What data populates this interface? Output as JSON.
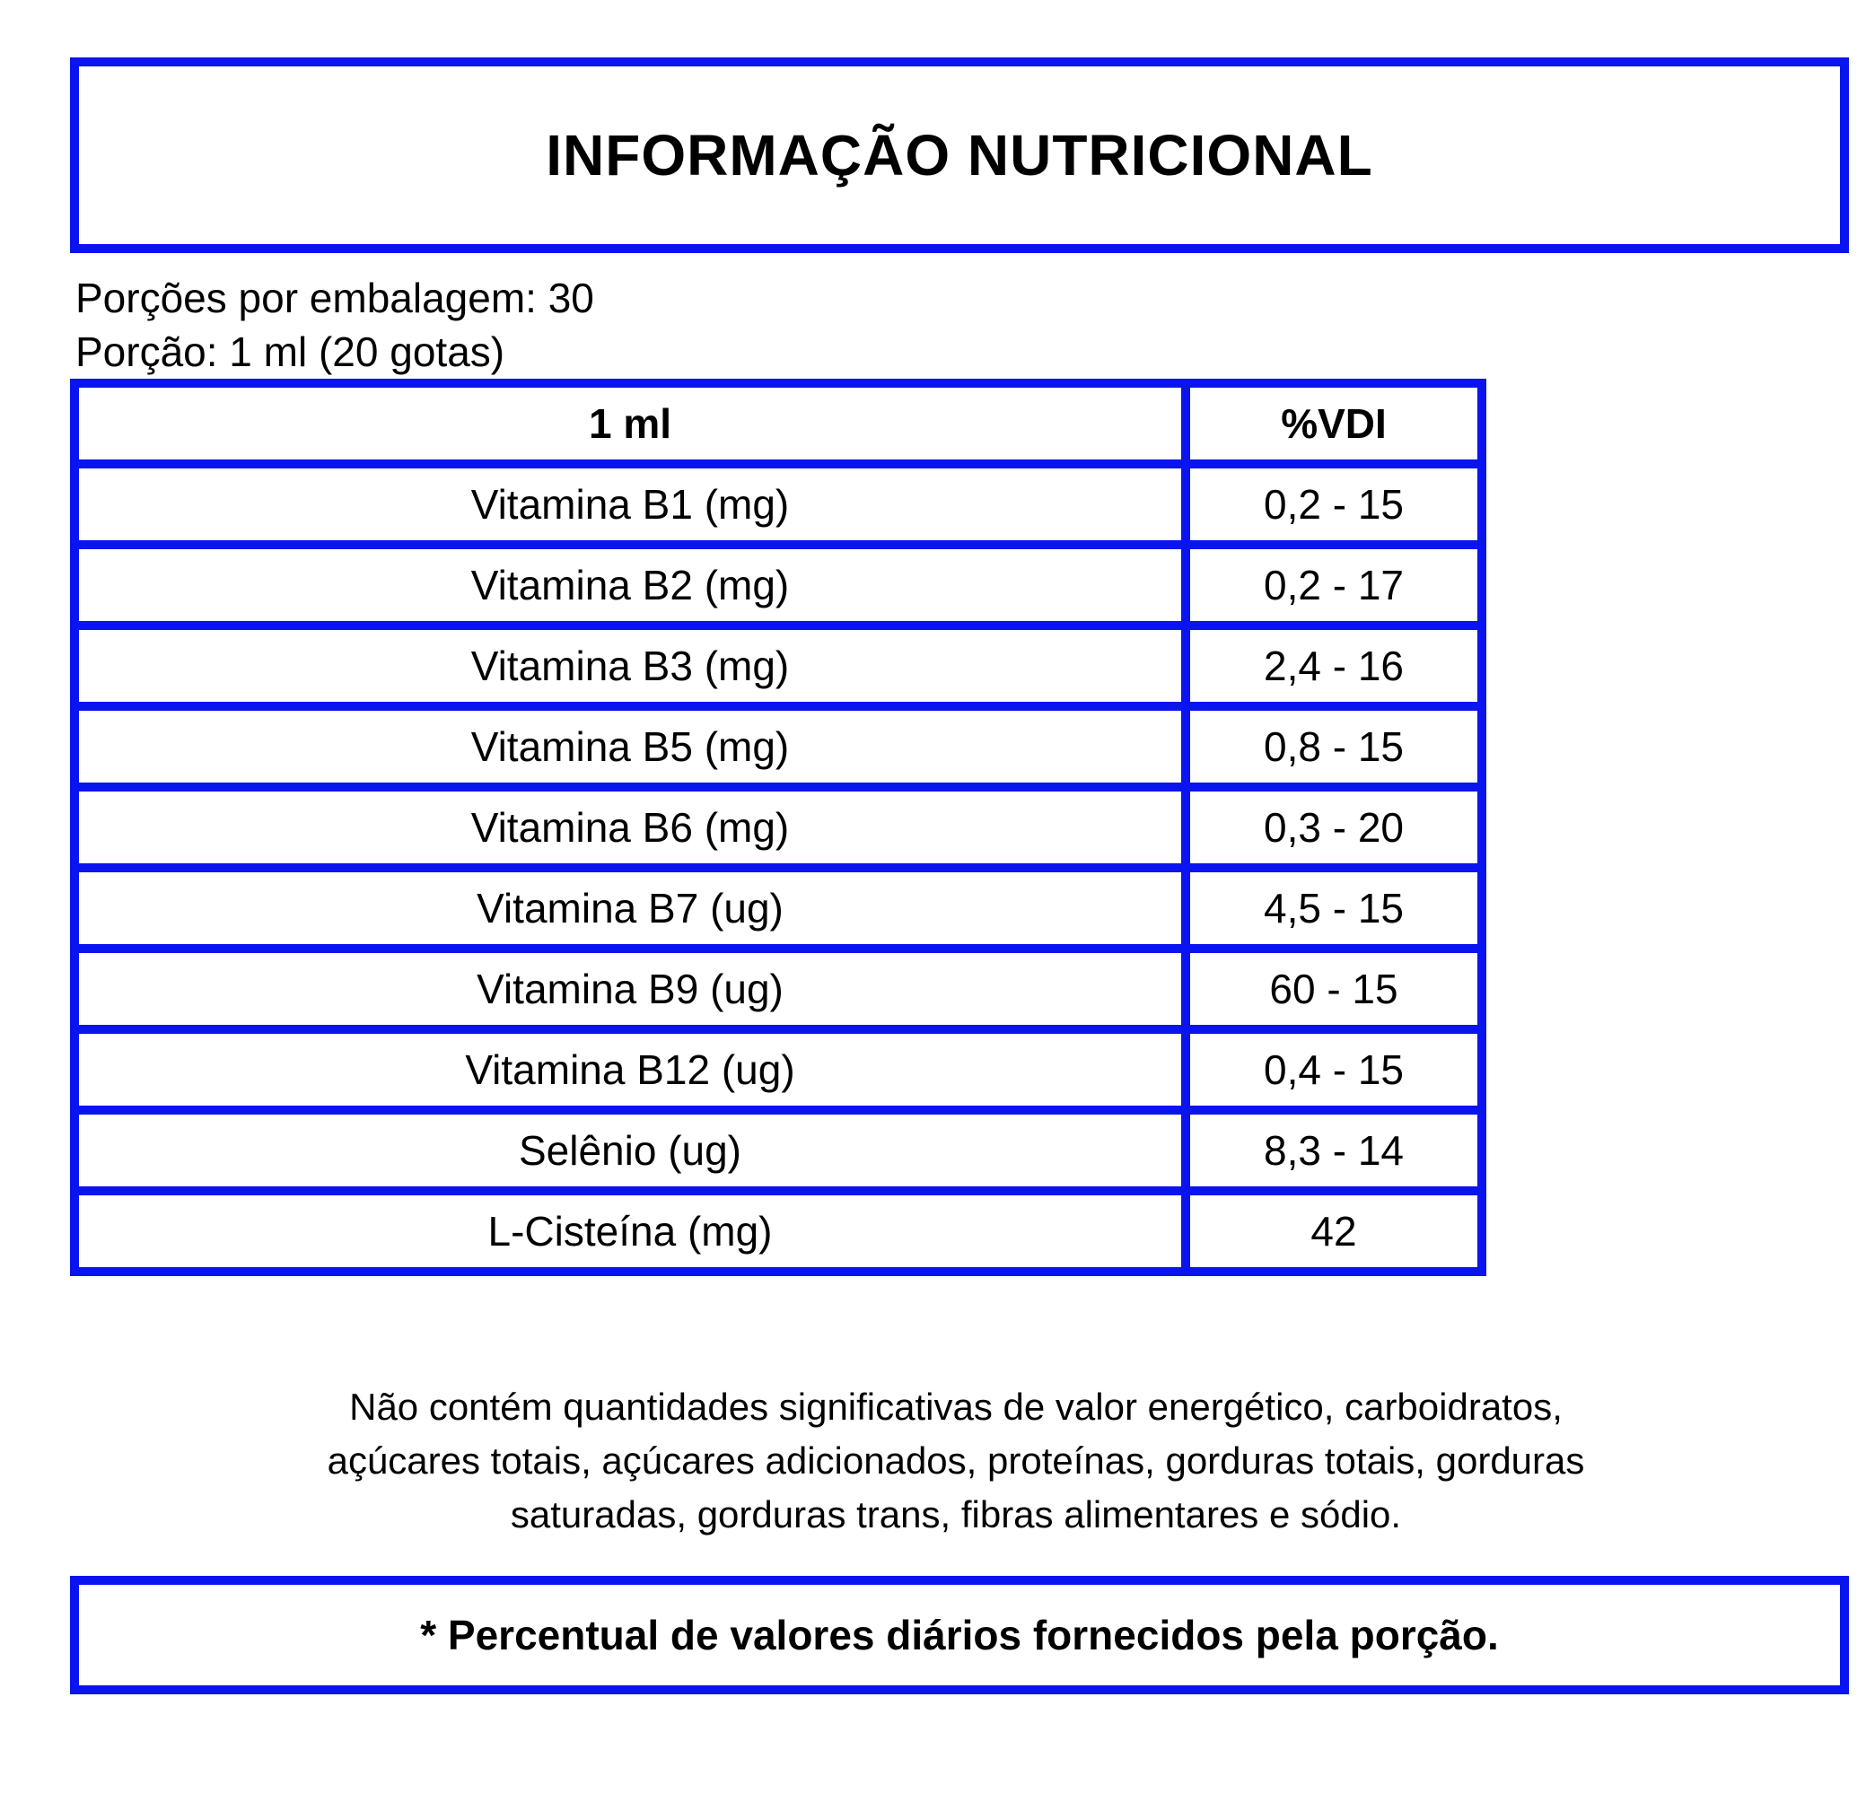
{
  "title": "INFORMAÇÃO NUTRICIONAL",
  "servings_per_package": "Porções por embalagem: 30",
  "serving_size": "Porção: 1 ml (20 gotas)",
  "table": {
    "headers": [
      "1 ml",
      "%VDI"
    ],
    "rows": [
      {
        "name": "Vitamina B1 (mg)",
        "value": "0,2 - 15"
      },
      {
        "name": "Vitamina B2 (mg)",
        "value": "0,2 - 17"
      },
      {
        "name": "Vitamina B3 (mg)",
        "value": "2,4 - 16"
      },
      {
        "name": "Vitamina B5 (mg)",
        "value": "0,8 - 15"
      },
      {
        "name": "Vitamina B6 (mg)",
        "value": "0,3 - 20"
      },
      {
        "name": "Vitamina B7 (ug)",
        "value": "4,5 - 15"
      },
      {
        "name": "Vitamina B9 (ug)",
        "value": "60 - 15"
      },
      {
        "name": "Vitamina B12 (ug)",
        "value": "0,4 - 15"
      },
      {
        "name": "Selênio (ug)",
        "value": "8,3 - 14"
      },
      {
        "name": "L-Cisteína (mg)",
        "value": "42"
      }
    ]
  },
  "footnote": "Não contém quantidades significativas de valor energético, carboidratos, açúcares totais, açúcares adicionados, proteínas, gorduras totais, gorduras saturadas, gorduras trans, fibras alimentares e sódio.",
  "daily_value_note": "* Percentual de valores diários fornecidos pela porção.",
  "colors": {
    "border": "#0a14f0",
    "text": "#000000",
    "background": "#ffffff"
  }
}
